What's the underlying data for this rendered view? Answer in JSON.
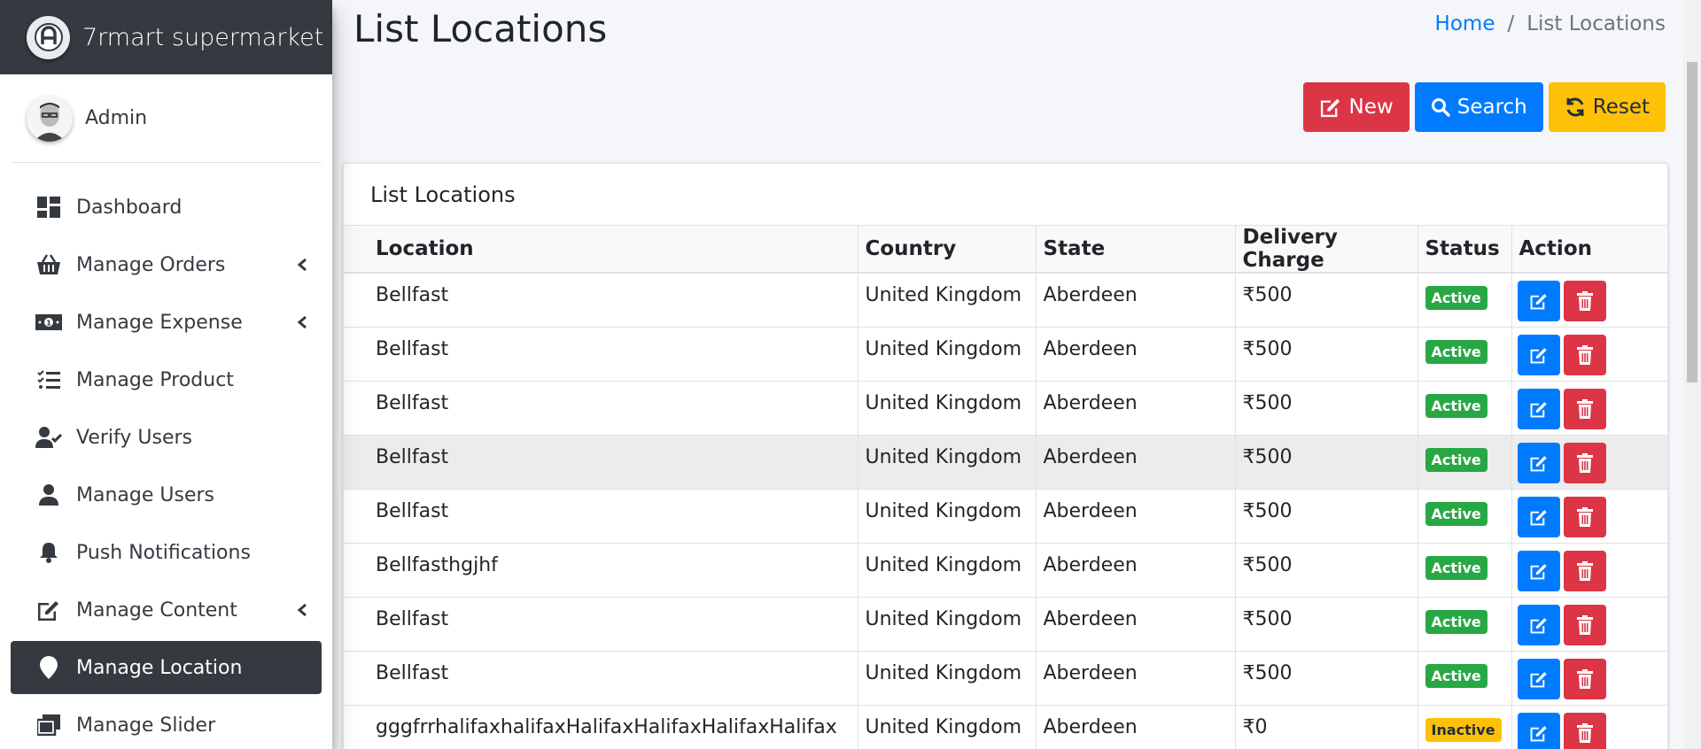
{
  "brand": {
    "name": "7rmart supermarket",
    "logo_icon": "brand-logo-icon"
  },
  "user": {
    "name": "Admin"
  },
  "sidebar": {
    "items": [
      {
        "label": "Dashboard",
        "icon": "dashboard-icon",
        "has_submenu": false
      },
      {
        "label": "Manage Orders",
        "icon": "basket-icon",
        "has_submenu": true
      },
      {
        "label": "Manage Expense",
        "icon": "money-icon",
        "has_submenu": true
      },
      {
        "label": "Manage Product",
        "icon": "tasks-icon",
        "has_submenu": false
      },
      {
        "label": "Verify Users",
        "icon": "user-check-icon",
        "has_submenu": false
      },
      {
        "label": "Manage Users",
        "icon": "user-icon",
        "has_submenu": false
      },
      {
        "label": "Push Notifications",
        "icon": "bell-icon",
        "has_submenu": false
      },
      {
        "label": "Manage Content",
        "icon": "edit-icon",
        "has_submenu": true
      },
      {
        "label": "Manage Location",
        "icon": "map-marker-icon",
        "has_submenu": false,
        "active": true
      },
      {
        "label": "Manage Slider",
        "icon": "images-icon",
        "has_submenu": false
      }
    ]
  },
  "page": {
    "title": "List Locations"
  },
  "breadcrumb": {
    "home": "Home",
    "separator": "/",
    "current": "List Locations"
  },
  "toolbar": {
    "new_label": "New",
    "search_label": "Search",
    "reset_label": "Reset"
  },
  "card": {
    "title": "List Locations"
  },
  "table": {
    "headers": [
      "Location",
      "Country",
      "State",
      "Delivery Charge",
      "Status",
      "Action"
    ],
    "rows": [
      {
        "location": "Bellfast",
        "country": "United Kingdom",
        "state": "Aberdeen",
        "charge": "₹500",
        "status": "Active"
      },
      {
        "location": "Bellfast",
        "country": "United Kingdom",
        "state": "Aberdeen",
        "charge": "₹500",
        "status": "Active"
      },
      {
        "location": "Bellfast",
        "country": "United Kingdom",
        "state": "Aberdeen",
        "charge": "₹500",
        "status": "Active"
      },
      {
        "location": "Bellfast",
        "country": "United Kingdom",
        "state": "Aberdeen",
        "charge": "₹500",
        "status": "Active"
      },
      {
        "location": "Bellfast",
        "country": "United Kingdom",
        "state": "Aberdeen",
        "charge": "₹500",
        "status": "Active"
      },
      {
        "location": "Bellfasthgjhf",
        "country": "United Kingdom",
        "state": "Aberdeen",
        "charge": "₹500",
        "status": "Active"
      },
      {
        "location": "Bellfast",
        "country": "United Kingdom",
        "state": "Aberdeen",
        "charge": "₹500",
        "status": "Active"
      },
      {
        "location": "Bellfast",
        "country": "United Kingdom",
        "state": "Aberdeen",
        "charge": "₹500",
        "status": "Active"
      },
      {
        "location": "gggfrrhalifaxhalifaxHalifaxHalifaxHalifaxHalifax",
        "country": "United Kingdom",
        "state": "Aberdeen",
        "charge": "₹0",
        "status": "Inactive"
      }
    ]
  },
  "colors": {
    "sidebar_dark": "#343a40",
    "primary": "#007bff",
    "danger": "#dc3545",
    "warning": "#ffc107",
    "success": "#28a745"
  }
}
